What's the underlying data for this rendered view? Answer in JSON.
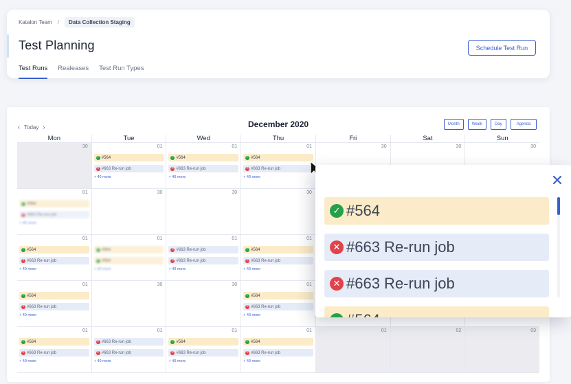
{
  "breadcrumb": {
    "team": "Katalon Team",
    "separator": "/",
    "project": "Data Collection Staging"
  },
  "page": {
    "title": "Test Planning",
    "schedule_button": "Schedule Test Run"
  },
  "tabs": [
    {
      "label": "Test Runs",
      "active": true
    },
    {
      "label": "Realeases",
      "active": false
    },
    {
      "label": "Test Run Types",
      "active": false
    }
  ],
  "calendar": {
    "today_label": "Today",
    "month_title": "December 2020",
    "views": [
      "Month",
      "Week",
      "Day",
      "Agenda"
    ],
    "weekdays": [
      "Mon",
      "Tue",
      "Wed",
      "Thu",
      "Fri",
      "Sat",
      "Sun"
    ],
    "event_ok_label": "#564",
    "event_fail_label": "#663 Re-run job",
    "more_label": "+ 40 more",
    "weeks": [
      [
        {
          "day": "30",
          "gray": true
        },
        {
          "day": "01",
          "events": true
        },
        {
          "day": "01",
          "events": true
        },
        {
          "day": "01",
          "events": true
        },
        {
          "day": "30"
        },
        {
          "day": "30"
        },
        {
          "day": "30"
        }
      ],
      [
        {
          "day": "01",
          "events": true,
          "blur": true
        },
        {
          "day": "30"
        },
        {
          "day": "30"
        },
        {
          "day": "30"
        },
        {
          "day": ""
        },
        {
          "day": ""
        },
        {
          "day": ""
        }
      ],
      [
        {
          "day": "01",
          "events": true
        },
        {
          "day": "01",
          "events": true,
          "blur": true,
          "ok_twice": true
        },
        {
          "day": "01",
          "events": true,
          "fail_twice": true
        },
        {
          "day": "01",
          "events": true
        },
        {
          "day": ""
        },
        {
          "day": ""
        },
        {
          "day": ""
        }
      ],
      [
        {
          "day": "01",
          "events": true
        },
        {
          "day": "30"
        },
        {
          "day": "30"
        },
        {
          "day": "01",
          "events": true
        },
        {
          "day": ""
        },
        {
          "day": ""
        },
        {
          "day": ""
        }
      ],
      [
        {
          "day": "01",
          "events": true
        },
        {
          "day": "01",
          "events": true,
          "fail_twice": true
        },
        {
          "day": "01",
          "events": true
        },
        {
          "day": "01",
          "events": true
        },
        {
          "day": "01",
          "gray": true
        },
        {
          "day": "02",
          "gray": true
        },
        {
          "day": "03",
          "gray": true
        }
      ]
    ]
  },
  "popover": {
    "events": [
      {
        "label": "#564",
        "status": "ok"
      },
      {
        "label": "#663 Re-run job",
        "status": "fail"
      },
      {
        "label": "#663 Re-run job",
        "status": "fail"
      },
      {
        "label": "#564",
        "status": "ok"
      }
    ]
  },
  "colors": {
    "accent": "#3a5fcf",
    "success": "#24a148",
    "error": "#e0434b",
    "ok_bg": "#fbebc8",
    "fail_bg": "#e6ecf7"
  }
}
